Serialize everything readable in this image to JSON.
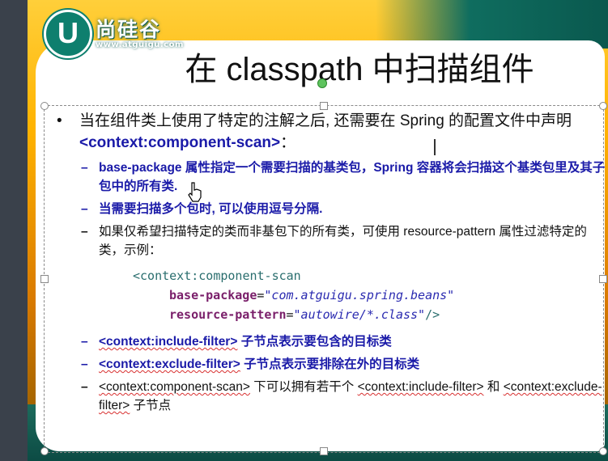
{
  "logo": {
    "letter": "U",
    "brand": "尚硅谷",
    "url": "www.atguigu.com"
  },
  "slide": {
    "title": "在 classpath 中扫描组件",
    "bullet_main": {
      "text_before": "当在组件类上使用了特定的注解之后, 还需要在 Spring 的配置文件中声明 ",
      "tag": "<context:component-scan>",
      "text_after": "："
    },
    "sub_items": [
      {
        "parts": [
          {
            "text": "base-package",
            "style": "blue"
          },
          {
            "text": " 属性指定一个需要扫描的基类包，",
            "style": "blue"
          },
          {
            "text": "Spring",
            "style": "blue"
          },
          {
            "text": " 容器将会扫描这个基类包里及其子包中的所有类.",
            "style": "blue"
          }
        ]
      },
      {
        "parts": [
          {
            "text": "当需要扫描多个包时, 可以使用逗号分隔.",
            "style": "blue"
          }
        ]
      },
      {
        "parts": [
          {
            "text": "如果仅希望扫描特定的类而非基包下的所有类，可使用 resource-pattern 属性过滤特定的类，示例：",
            "style": "plain"
          }
        ]
      }
    ],
    "code": {
      "line1_tag": "<context:component-scan",
      "line2_attr": "base-package",
      "line2_eq": "=",
      "line2_val": "\"com.atguigu.spring.beans\"",
      "line3_attr": "resource-pattern",
      "line3_eq": "=",
      "line3_val": "\"autowire/*.class\"",
      "line3_close": "/>"
    },
    "sub_items_after": [
      {
        "tag": "<context:include-filter>",
        "text": " 子节点表示要包含的目标类",
        "style": "blue"
      },
      {
        "tag": "<context:exclude-filter>",
        "text": " 子节点表示要排除在外的目标类",
        "style": "blue"
      },
      {
        "tag": "<context:component-scan>",
        "text": " 下可以拥有若干个 ",
        "tag2": "<context:include-filter>",
        "text2": " 和 ",
        "tag3": "<context:exclude-filter>",
        "text3": " 子节点",
        "style": "plain"
      }
    ]
  }
}
